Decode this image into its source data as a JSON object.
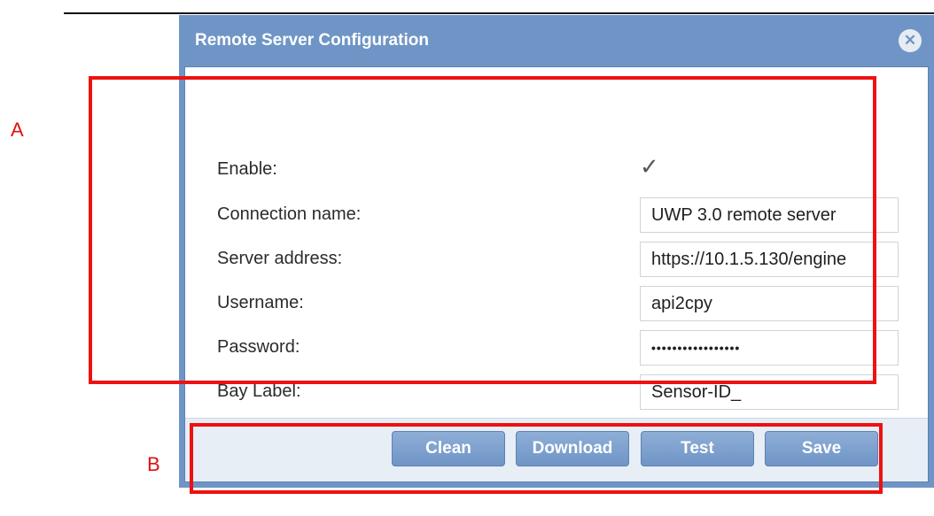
{
  "callouts": {
    "a": "A",
    "b": "B"
  },
  "dialog": {
    "title": "Remote Server Configuration",
    "close_icon": "close-icon",
    "close_glyph": "✕"
  },
  "form": {
    "enable": {
      "label": "Enable:",
      "checked": true,
      "glyph": "✓"
    },
    "connection_name": {
      "label": "Connection name:",
      "value": "UWP 3.0 remote server"
    },
    "server_address": {
      "label": "Server address:",
      "value": "https://10.1.5.130/engine"
    },
    "username": {
      "label": "Username:",
      "value": "api2cpy"
    },
    "password": {
      "label": "Password:",
      "value": "•••••••••••••••••"
    },
    "bay_label": {
      "label": "Bay Label:",
      "value": "Sensor-ID_"
    }
  },
  "buttons": {
    "clean": "Clean",
    "download": "Download",
    "test": "Test",
    "save": "Save"
  },
  "colors": {
    "dialog_frame": "#6f95c6",
    "highlight": "#ee1111",
    "footer_bg": "#e8eef6"
  }
}
